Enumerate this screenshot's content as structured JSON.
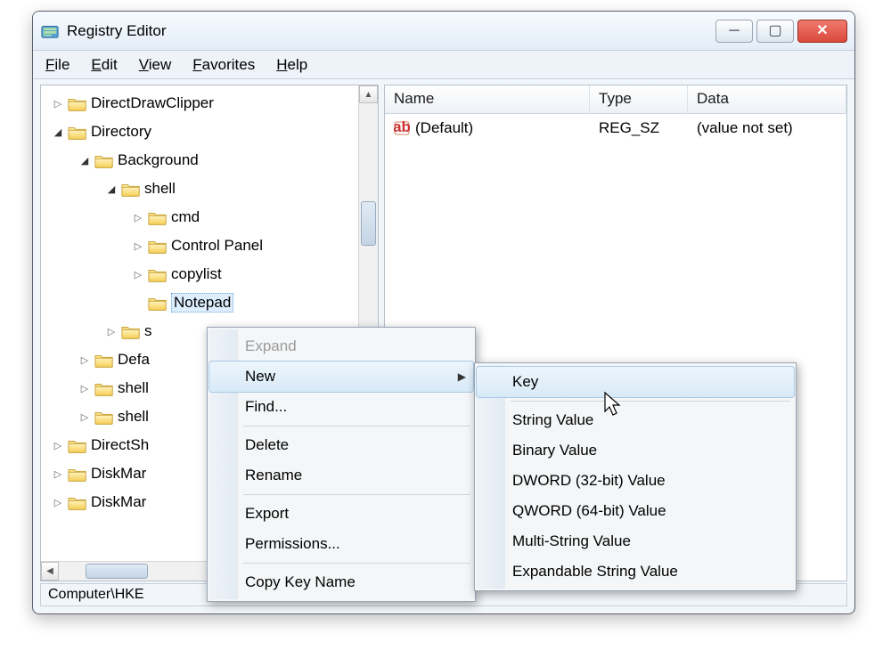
{
  "window": {
    "title": "Registry Editor"
  },
  "menu": {
    "file": "File",
    "edit": "Edit",
    "view": "View",
    "favorites": "Favorites",
    "help": "Help"
  },
  "tree": [
    {
      "level": 0,
      "exp": "closed",
      "label": "DirectDrawClipper"
    },
    {
      "level": 0,
      "exp": "open",
      "label": "Directory"
    },
    {
      "level": 1,
      "exp": "open",
      "label": "Background"
    },
    {
      "level": 2,
      "exp": "open",
      "label": "shell"
    },
    {
      "level": 3,
      "exp": "closed",
      "label": "cmd"
    },
    {
      "level": 3,
      "exp": "closed",
      "label": "Control Panel"
    },
    {
      "level": 3,
      "exp": "closed",
      "label": "copylist"
    },
    {
      "level": 3,
      "exp": "none",
      "label": "Notepad",
      "selected": true
    },
    {
      "level": 2,
      "exp": "closed",
      "label": "s"
    },
    {
      "level": 1,
      "exp": "closed",
      "label": "Defa"
    },
    {
      "level": 1,
      "exp": "closed",
      "label": "shell"
    },
    {
      "level": 1,
      "exp": "closed",
      "label": "shell"
    },
    {
      "level": 0,
      "exp": "closed",
      "label": "DirectSh"
    },
    {
      "level": 0,
      "exp": "closed",
      "label": "DiskMar"
    },
    {
      "level": 0,
      "exp": "closed",
      "label": "DiskMar"
    }
  ],
  "details": {
    "columns": [
      "Name",
      "Type",
      "Data"
    ],
    "rows": [
      {
        "name": "(Default)",
        "type": "REG_SZ",
        "data": "(value not set)"
      }
    ]
  },
  "statusbar": "Computer\\HKE",
  "ctx1": {
    "items": [
      {
        "label": "Expand",
        "disabled": true
      },
      {
        "label": "New",
        "sub": true,
        "active": true
      },
      {
        "label": "Find..."
      },
      {
        "sep": true
      },
      {
        "label": "Delete"
      },
      {
        "label": "Rename"
      },
      {
        "sep": true
      },
      {
        "label": "Export"
      },
      {
        "label": "Permissions..."
      },
      {
        "sep": true
      },
      {
        "label": "Copy Key Name"
      }
    ]
  },
  "ctx2": {
    "items": [
      {
        "label": "Key",
        "active": true
      },
      {
        "sep": true
      },
      {
        "label": "String Value"
      },
      {
        "label": "Binary Value"
      },
      {
        "label": "DWORD (32-bit) Value"
      },
      {
        "label": "QWORD (64-bit) Value"
      },
      {
        "label": "Multi-String Value"
      },
      {
        "label": "Expandable String Value"
      }
    ]
  }
}
